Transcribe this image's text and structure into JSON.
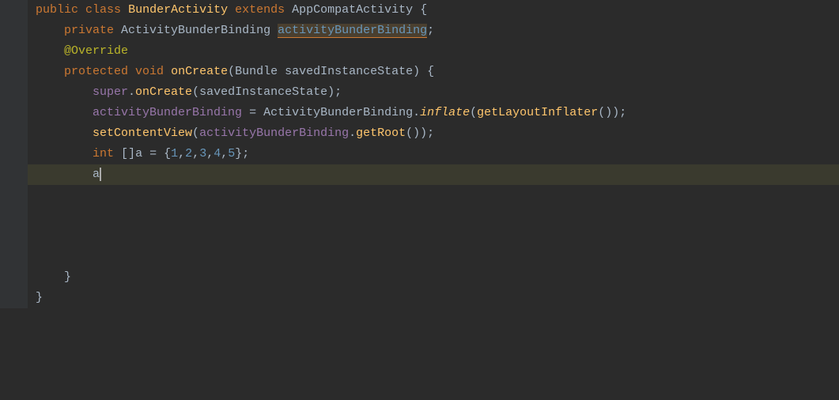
{
  "editor": {
    "background": "#2b2b2b",
    "lines": [
      {
        "number": "",
        "indent": 0,
        "content": "public class BunderActivity extends AppCompatActivity {",
        "highlighted": false,
        "current": false
      },
      {
        "number": "",
        "indent": 1,
        "content": "private ActivityBunderBinding activityBunderBinding;",
        "highlighted": false,
        "current": false
      },
      {
        "number": "",
        "indent": 1,
        "content": "@Override",
        "highlighted": false,
        "current": false
      },
      {
        "number": "",
        "indent": 1,
        "content": "protected void onCreate(Bundle savedInstanceState) {",
        "highlighted": false,
        "current": false
      },
      {
        "number": "",
        "indent": 2,
        "content": "super.onCreate(savedInstanceState);",
        "highlighted": false,
        "current": false
      },
      {
        "number": "",
        "indent": 2,
        "content": "activityBunderBinding = ActivityBunderBinding.inflate(getLayoutInflater());",
        "highlighted": false,
        "current": false
      },
      {
        "number": "",
        "indent": 2,
        "content": "setContentView(activityBunderBinding.getRoot());",
        "highlighted": false,
        "current": false
      },
      {
        "number": "",
        "indent": 2,
        "content": "int []a = {1,2,3,4,5};",
        "highlighted": false,
        "current": false
      },
      {
        "number": "",
        "indent": 2,
        "content": "a",
        "highlighted": true,
        "current": true
      }
    ]
  }
}
